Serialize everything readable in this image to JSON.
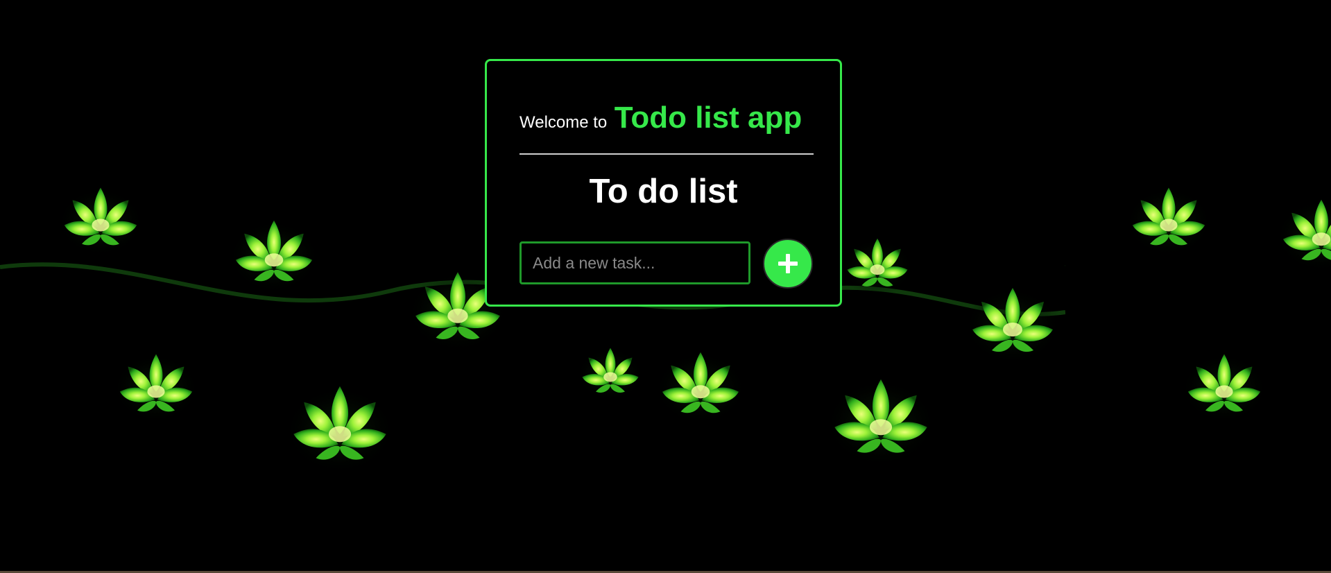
{
  "header": {
    "welcome_prefix": "Welcome to",
    "app_name": "Todo list app"
  },
  "list": {
    "title": "To do list"
  },
  "task_input": {
    "placeholder": "Add a new task...",
    "value": ""
  },
  "add_button": {
    "icon": "plus-icon"
  },
  "colors": {
    "accent": "#36e84a",
    "input_border": "#1f9a2a",
    "background": "#000000",
    "text": "#ffffff"
  },
  "background_image": {
    "icon": "green-lotus-flowers"
  }
}
